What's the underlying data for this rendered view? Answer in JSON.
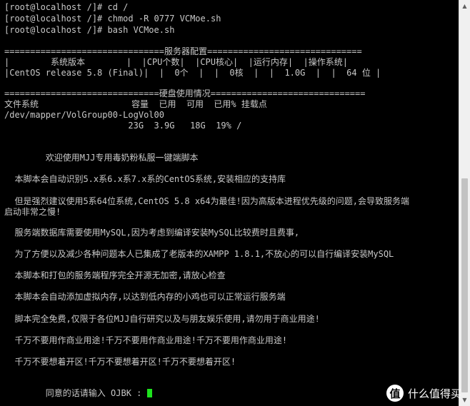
{
  "terminal": {
    "lines": [
      "[root@localhost /]# cd /",
      "[root@localhost /]# chmod -R 0777 VCMoe.sh",
      "[root@localhost /]# bash VCMoe.sh",
      "",
      "",
      "===============================服务器配置==============================",
      "|        系统版本        |  |CPU个数|  |CPU核心|  |运行内存|  |操作系统|",
      "|CentOS release 5.8 (Final)|  |  0个  |  |  0核  |  |  1.0G  |  |  64 位 |",
      "",
      "==============================硬盘使用情况==============================",
      "文件系统                  容量  已用  可用  已用% 挂载点",
      "/dev/mapper/VolGroup00-LogVol00",
      "                        23G  3.9G   18G  19% /",
      "",
      "",
      "",
      "        欢迎使用MJJ专用毒奶粉私服一键端脚本",
      "",
      "  本脚本会自动识别5.x系6.x系7.x系的CentOS系统,安装相应的支持库",
      "",
      "  但是强烈建议使用5系64位系统,CentOS 5.8 x64为最佳!因为高版本进程优先级的问题,会导致服务端",
      "启动非常之慢!",
      "",
      "  服务端数据库需要使用MySQL,因为考虑到编译安装MySQL比较费时且费事,",
      "",
      "  为了方便以及减少各种问题本人已集成了老版本的XAMPP 1.8.1,不放心的可以自行编译安装MySQL",
      "",
      "  本脚本和打包的服务端程序完全开源无加密,请放心检查",
      "",
      "  本脚本会自动添加虚拟内存,以达到低内存的小鸡也可以正常运行服务端",
      "",
      "  脚本完全免费,仅限于各位MJJ自行研究以及与朋友娱乐使用,请勿用于商业用途!",
      "",
      "  千万不要用作商业用途!千万不要用作商业用途!千万不要用作商业用途!",
      "",
      "  千万不要想着开区!千万不要想着开区!千万不要想着开区!",
      "",
      "",
      "        同意的话请输入 OJBK : "
    ]
  },
  "watermark": {
    "logo": "值",
    "text": "什么值得买"
  },
  "colors": {
    "background": "#000000",
    "foreground": "#c8c8c8",
    "cursor": "#1de21d"
  },
  "icons": [
    "scroll-up-icon",
    "scroll-down-icon",
    "smzdm-logo-icon"
  ]
}
